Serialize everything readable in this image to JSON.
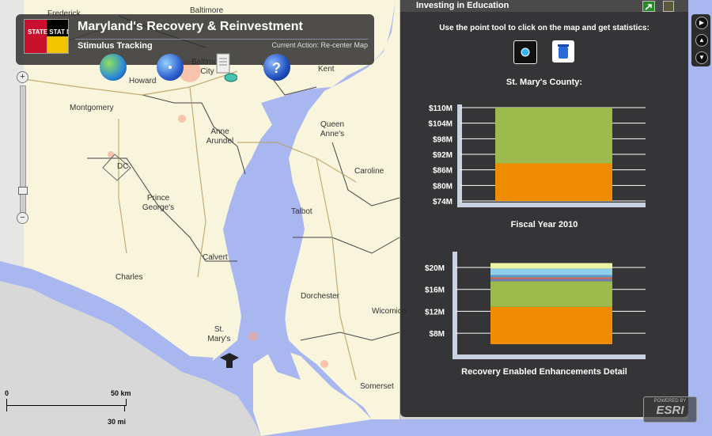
{
  "header": {
    "title": "Maryland's Recovery & Reinvestment",
    "subtitle": "Stimulus Tracking",
    "current_action": "Current Action: Re-center Map",
    "logo_text": "STATE STAT MARYLAND"
  },
  "tools": [
    "globe-icon",
    "compass-icon",
    "document-icon",
    "help-icon"
  ],
  "map": {
    "places": [
      {
        "id": "frederick",
        "name": "Frederick"
      },
      {
        "id": "baltimore",
        "name": "Baltimore"
      },
      {
        "id": "baltimore-city",
        "name": "Baltimore City"
      },
      {
        "id": "howard",
        "name": "Howard"
      },
      {
        "id": "kent",
        "name": "Kent"
      },
      {
        "id": "montgomery",
        "name": "Montgomery"
      },
      {
        "id": "anne-arundel",
        "name": "Anne Arundel"
      },
      {
        "id": "queen-annes",
        "name": "Queen Anne's"
      },
      {
        "id": "dc",
        "name": "DC"
      },
      {
        "id": "caroline",
        "name": "Caroline"
      },
      {
        "id": "prince-georges",
        "name": "Prince George's"
      },
      {
        "id": "talbot",
        "name": "Talbot"
      },
      {
        "id": "calvert",
        "name": "Calvert"
      },
      {
        "id": "charles",
        "name": "Charles"
      },
      {
        "id": "dorchester",
        "name": "Dorchester"
      },
      {
        "id": "wicomico",
        "name": "Wicomico"
      },
      {
        "id": "st-marys",
        "name": "St. Mary's"
      },
      {
        "id": "somerset",
        "name": "Somerset"
      }
    ],
    "colors": {
      "water": "#a9b7f0",
      "land": "#f8f5dc",
      "grey": "#d8d8d8",
      "urban": "#f7a38a"
    }
  },
  "zoom": {
    "plus": "+",
    "minus": "−"
  },
  "scale": {
    "zero": "0",
    "km": "50 km",
    "mi": "30 mi"
  },
  "panel": {
    "title": "Investing in Education",
    "instructions": "Use the point tool to click on the map and get statistics:",
    "county": "St. Mary's County:",
    "chart1_label": "Fiscal Year 2010",
    "chart2_label": "Recovery Enabled Enhancements Detail"
  },
  "esri": {
    "top": "POWERED BY",
    "bottom": "ESRI"
  },
  "chart_data": [
    {
      "type": "bar",
      "stacked": true,
      "ylim": [
        74,
        110
      ],
      "ytick_labels": [
        "$110M",
        "$104M",
        "$98M",
        "$92M",
        "$86M",
        "$80M",
        "$74M"
      ],
      "yticks": [
        110,
        104,
        98,
        92,
        86,
        80,
        74
      ],
      "series": [
        {
          "values": [
            88.5
          ],
          "color": "#f08c00"
        },
        {
          "values": [
            21.5
          ],
          "color": "#9dba4c"
        }
      ]
    },
    {
      "type": "bar",
      "stacked": true,
      "ylim": [
        6,
        20
      ],
      "ytick_labels": [
        "$20M",
        "$16M",
        "$12M",
        "$8M"
      ],
      "yticks": [
        20,
        16,
        12,
        8
      ],
      "series": [
        {
          "values": [
            12.8
          ],
          "color": "#f08c00"
        },
        {
          "values": [
            4.7
          ],
          "color": "#9dba4c"
        },
        {
          "values": [
            0.4
          ],
          "color": "#6a7fb8"
        },
        {
          "values": [
            0.3
          ],
          "color": "#d86a4a"
        },
        {
          "values": [
            0.4
          ],
          "color": "#5a9bd0"
        },
        {
          "values": [
            1.2
          ],
          "color": "#8fd0e8"
        },
        {
          "values": [
            1.0
          ],
          "color": "#eef5a0"
        }
      ]
    }
  ]
}
